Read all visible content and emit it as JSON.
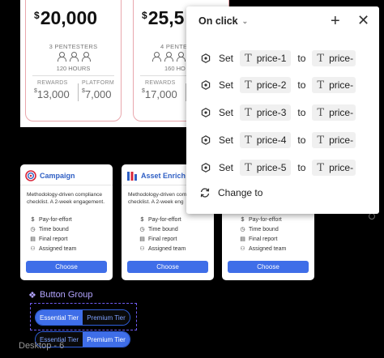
{
  "pricing_cards": [
    {
      "amount": "20,000",
      "pentesters": "3 PENTESTERS",
      "hours": "120 HOURS",
      "rewards_label": "REWARDS",
      "rewards_value": "13,000",
      "platform_label": "PLATFORM",
      "platform_value": "7,000"
    },
    {
      "amount": "25,5",
      "pentesters": "4 PENTES",
      "hours": "160 HO",
      "rewards_label": "REWARDS",
      "rewards_value": "17,000",
      "platform_label": "P",
      "platform_value": ""
    }
  ],
  "currency": "$",
  "feature_cards": [
    {
      "name": "Campaign",
      "icon": "target-icon",
      "description": "Methodology-driven compliance checklist. A 2-week engagement.",
      "features": [
        "Pay-for-effort",
        "Time bound",
        "Final report",
        "Assigned team"
      ],
      "button": "Choose"
    },
    {
      "name": "Asset Enrich",
      "icon": "bars-icon",
      "description": "Methodology-driven com checklist. A 2-week eng",
      "features": [
        "Pay-for-effort",
        "Time bound",
        "Final report",
        "Assigned team"
      ],
      "button": "Choose"
    },
    {
      "name": "",
      "icon": "",
      "description": "",
      "features": [
        "Pay-for-effort",
        "Time bound",
        "Final report",
        "Assigned team"
      ],
      "button": "Choose"
    }
  ],
  "button_group": {
    "label": "Button Group",
    "group1": [
      "Essential Tier",
      "Premium Tier"
    ],
    "group2": [
      "Essential Tier",
      "Premium Tier"
    ]
  },
  "desktop_label": "Desktop - 6",
  "interaction_panel": {
    "trigger": "On click",
    "actions": [
      {
        "verb": "Set",
        "target": "price-1",
        "to": "to",
        "value": "price-"
      },
      {
        "verb": "Set",
        "target": "price-2",
        "to": "to",
        "value": "price-"
      },
      {
        "verb": "Set",
        "target": "price-3",
        "to": "to",
        "value": "price-"
      },
      {
        "verb": "Set",
        "target": "price-4",
        "to": "to",
        "value": "price-"
      },
      {
        "verb": "Set",
        "target": "price-5",
        "to": "to",
        "value": "price-"
      }
    ],
    "change_to": "Change to"
  },
  "colors": {
    "accent": "#3f6ee8",
    "selection": "#6f5cf0",
    "card_border": "#e9a7ad"
  }
}
